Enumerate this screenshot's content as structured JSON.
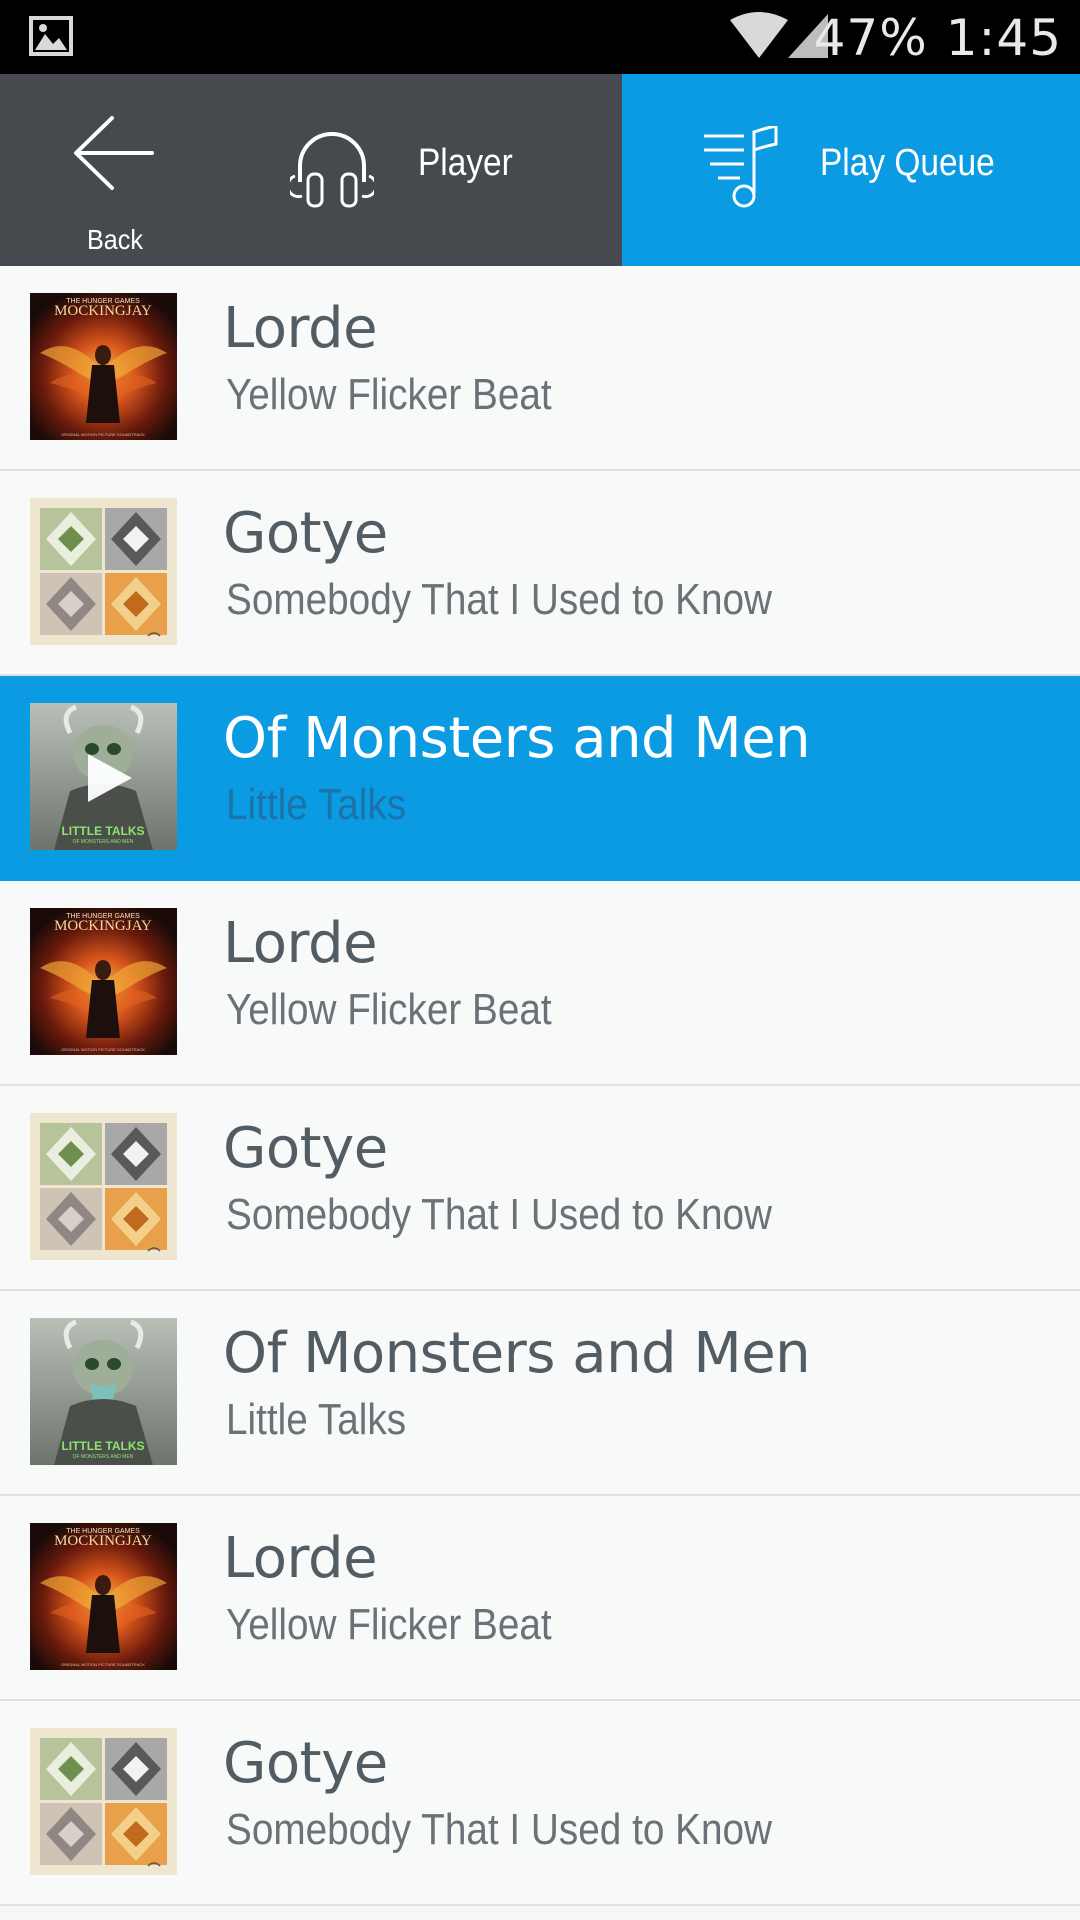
{
  "status_bar": {
    "battery": "47%",
    "time": "1:45",
    "icons": [
      "gallery-icon",
      "wifi-icon",
      "signal-icon"
    ]
  },
  "header": {
    "back_label": "Back",
    "player_label": "Player",
    "queue_label": "Play Queue",
    "colors": {
      "left_bg": "#464a4e",
      "accent": "#0a9be2"
    }
  },
  "queue": [
    {
      "artist": "Lorde",
      "title": "Yellow Flicker Beat",
      "art": "mockingjay",
      "active": false
    },
    {
      "artist": "Gotye",
      "title": "Somebody That I Used to Know",
      "art": "gotye",
      "active": false
    },
    {
      "artist": "Of Monsters and Men",
      "title": "Little Talks",
      "art": "monsters",
      "active": true
    },
    {
      "artist": "Lorde",
      "title": "Yellow Flicker Beat",
      "art": "mockingjay",
      "active": false
    },
    {
      "artist": "Gotye",
      "title": "Somebody That I Used to Know",
      "art": "gotye",
      "active": false
    },
    {
      "artist": "Of Monsters and Men",
      "title": "Little Talks",
      "art": "monsters",
      "active": false
    },
    {
      "artist": "Lorde",
      "title": "Yellow Flicker Beat",
      "art": "mockingjay",
      "active": false
    },
    {
      "artist": "Gotye",
      "title": "Somebody That I Used to Know",
      "art": "gotye",
      "active": false
    }
  ],
  "album_art_text": {
    "mockingjay_top": "THE HUNGER GAMES",
    "mockingjay_title": "MOCKINGJAY",
    "mockingjay_bottom": "ORIGINAL MOTION PICTURE SOUNDTRACK",
    "monsters_title": "LITTLE TALKS",
    "monsters_sub": "OF MONSTERS AND MEN"
  }
}
